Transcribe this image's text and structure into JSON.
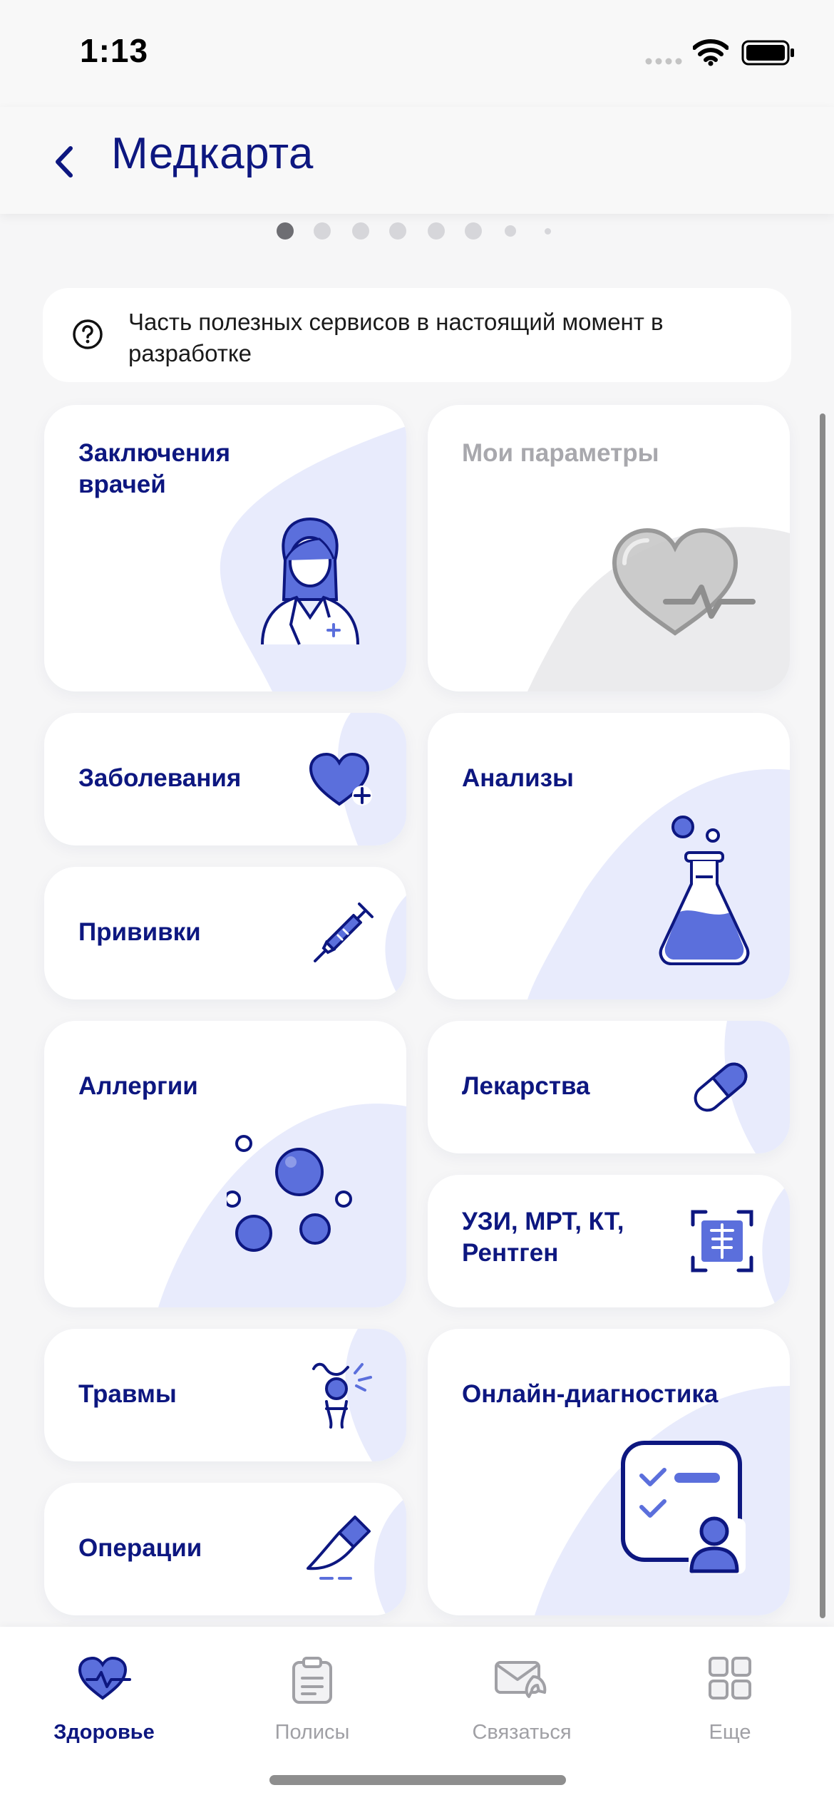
{
  "status_bar": {
    "time": "1:13"
  },
  "header": {
    "title": "Медкарта",
    "back_icon": "chevron-left-icon"
  },
  "pager": {
    "count": 8,
    "active_index": 0
  },
  "notice": {
    "text": "Часть полезных сервисов в настоящий момент в разработке",
    "icon": "question-circle-icon"
  },
  "cards": {
    "doctors": {
      "label": "Заключения врачей",
      "icon": "doctor-icon"
    },
    "params": {
      "label": "Мои параметры",
      "icon": "heart-pulse-icon",
      "disabled": true
    },
    "diseases": {
      "label": "Заболевания",
      "icon": "heart-plus-icon"
    },
    "analyses": {
      "label": "Анализы",
      "icon": "flask-icon"
    },
    "vaccines": {
      "label": "Прививки",
      "icon": "syringe-icon"
    },
    "allergies": {
      "label": "Аллергии",
      "icon": "bubbles-icon"
    },
    "medicines": {
      "label": "Лекарства",
      "icon": "pill-icon"
    },
    "imaging": {
      "label": "УЗИ, МРТ, КТ, Рентген",
      "icon": "xray-scan-icon"
    },
    "injuries": {
      "label": "Травмы",
      "icon": "injury-icon"
    },
    "diagnostics": {
      "label": "Онлайн-диагностика",
      "icon": "checklist-user-icon"
    },
    "operations": {
      "label": "Операции",
      "icon": "scalpel-icon"
    }
  },
  "tabs": [
    {
      "label": "Здоровье",
      "icon": "heart-pulse-icon",
      "active": true
    },
    {
      "label": "Полисы",
      "icon": "clipboard-icon",
      "active": false
    },
    {
      "label": "Связаться",
      "icon": "envelope-phone-icon",
      "active": false
    },
    {
      "label": "Еще",
      "icon": "grid-icon",
      "active": false
    }
  ],
  "colors": {
    "brand": "#0d1780",
    "accent": "#5b6fdc",
    "blob": "#e8ebfc",
    "muted": "#a8a8ad",
    "background": "#f6f6f7"
  }
}
